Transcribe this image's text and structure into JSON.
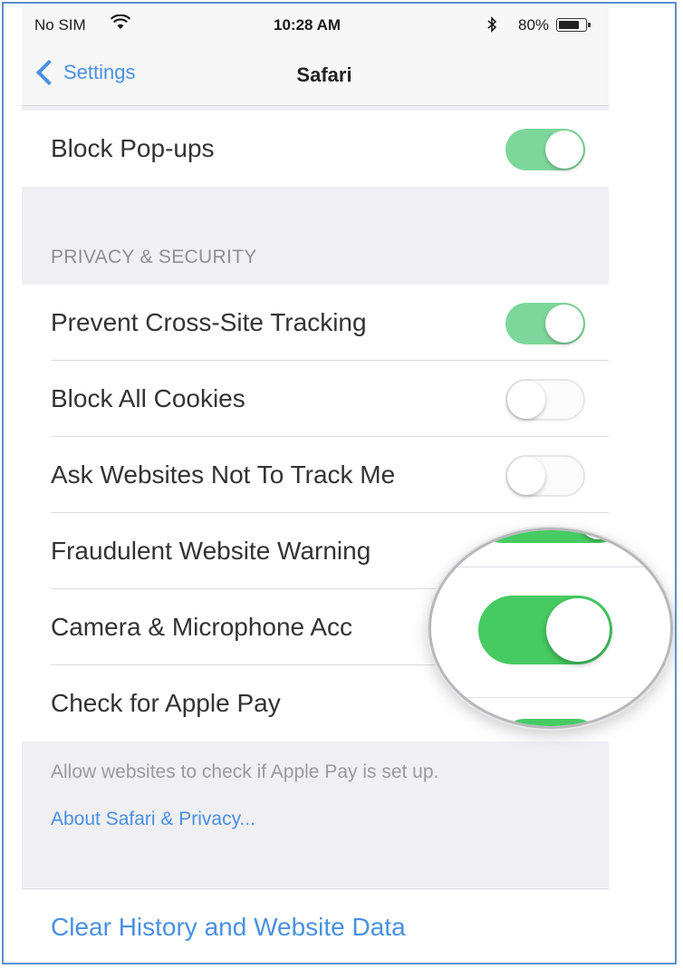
{
  "status_bar": {
    "carrier": "No SIM",
    "wifi_icon": "wifi-icon",
    "time": "10:28 AM",
    "bluetooth_icon": "bluetooth-icon",
    "battery_text": "80%",
    "battery_level": 0.8
  },
  "nav": {
    "back_label": "Settings",
    "title": "Safari"
  },
  "general": {
    "block_popups": {
      "label": "Block Pop-ups",
      "on": true
    }
  },
  "privacy": {
    "header": "PRIVACY & SECURITY",
    "rows": [
      {
        "label": "Prevent Cross-Site Tracking",
        "on": true
      },
      {
        "label": "Block All Cookies",
        "on": false
      },
      {
        "label": "Ask Websites Not To Track Me",
        "on": false
      },
      {
        "label": "Fraudulent Website Warning",
        "on": true
      },
      {
        "label": "Camera & Microphone Acc",
        "on": true
      },
      {
        "label": "Check for Apple Pay",
        "on": true
      }
    ],
    "footer_text": "Allow websites to check if Apple Pay is set up.",
    "footer_link": "About Safari & Privacy..."
  },
  "clear_history": {
    "label": "Clear History and Website Data"
  },
  "colors": {
    "accent": "#4a90e2",
    "toggle_on": "#7ed79a",
    "toggle_on_magnified": "#46cb62",
    "background": "#efeff4"
  }
}
